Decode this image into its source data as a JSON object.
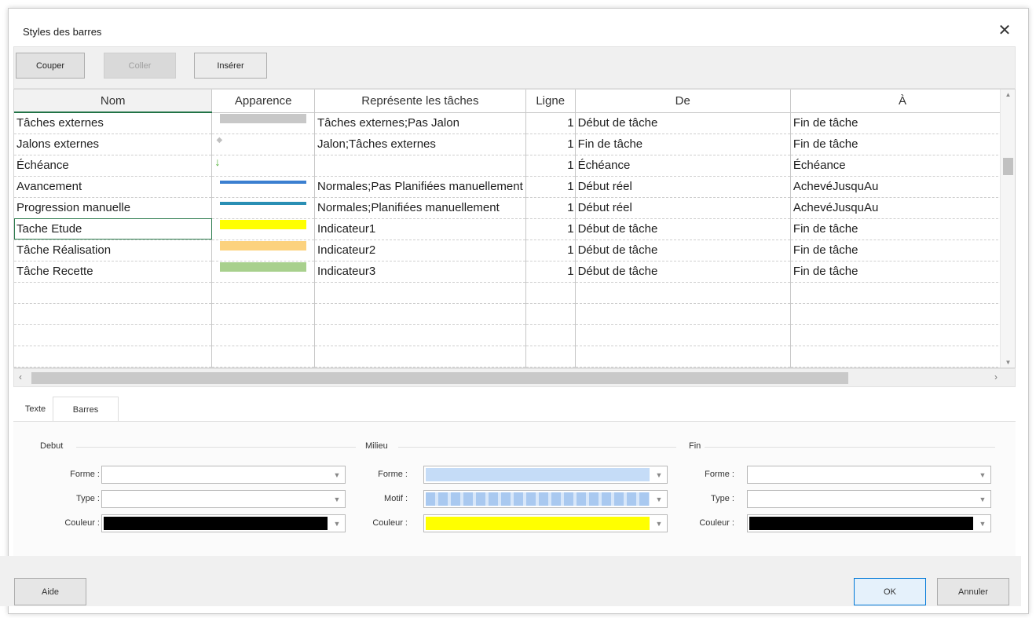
{
  "dialog": {
    "title": "Styles des barres",
    "close": "✕"
  },
  "toolbar": {
    "couper": "Couper",
    "coller": "Coller",
    "inserer": "Insérer"
  },
  "grid": {
    "headers": [
      "Nom",
      "Apparence",
      "Représente les tâches",
      "Ligne",
      "De",
      "À"
    ],
    "rows": [
      {
        "nom": "Tâches externes",
        "appearance": "gray-bar",
        "represente": "Tâches externes;Pas Jalon",
        "ligne": "1",
        "de": "Début de tâche",
        "a": "Fin de tâche"
      },
      {
        "nom": "Jalons externes",
        "appearance": "gray-diamond",
        "represente": "Jalon;Tâches externes",
        "ligne": "1",
        "de": "Fin de tâche",
        "a": "Fin de tâche"
      },
      {
        "nom": "Échéance",
        "appearance": "green-arrow",
        "represente": "",
        "ligne": "1",
        "de": "Échéance",
        "a": "Échéance"
      },
      {
        "nom": "Avancement",
        "appearance": "blue-line",
        "represente": "Normales;Pas Planifiées manuellement",
        "ligne": "1",
        "de": "Début réel",
        "a": "AchevéJusquAu"
      },
      {
        "nom": "Progression manuelle",
        "appearance": "teal-line",
        "represente": "Normales;Planifiées manuellement",
        "ligne": "1",
        "de": "Début réel",
        "a": "AchevéJusquAu"
      },
      {
        "nom": "Tache Etude",
        "appearance": "yellow-bar",
        "represente": "Indicateur1",
        "ligne": "1",
        "de": "Début de tâche",
        "a": "Fin de tâche"
      },
      {
        "nom": "Tâche Réalisation",
        "appearance": "orange-bar",
        "represente": "Indicateur2",
        "ligne": "1",
        "de": "Début de tâche",
        "a": "Fin de tâche"
      },
      {
        "nom": "Tâche Recette",
        "appearance": "green-bar",
        "represente": "Indicateur3",
        "ligne": "1",
        "de": "Début de tâche",
        "a": "Fin de tâche"
      }
    ],
    "appearance_colors": {
      "gray-bar": "#c8c8c8",
      "gray-diamond": "#c0c0c0",
      "green-arrow": "#4caf30",
      "blue-line": "#3b7fd0",
      "teal-line": "#2a8fb4",
      "yellow-bar": "#ffff00",
      "orange-bar": "#fcd27e",
      "green-bar": "#a8d08d"
    }
  },
  "tabs": {
    "texte": "Texte",
    "barres": "Barres"
  },
  "panel": {
    "debut": {
      "title": "Debut",
      "forme_label": "Forme :",
      "type_label": "Type :",
      "couleur_label": "Couleur :",
      "couleur": "#000000"
    },
    "milieu": {
      "title": "Milieu",
      "forme_label": "Forme :",
      "motif_label": "Motif :",
      "couleur_label": "Couleur :",
      "forme_color": "#c5dcf7",
      "motif_color": "#a9c9f0",
      "couleur": "#ffff00"
    },
    "fin": {
      "title": "Fin",
      "forme_label": "Forme :",
      "type_label": "Type :",
      "couleur_label": "Couleur :",
      "couleur": "#000000"
    }
  },
  "footer": {
    "aide": "Aide",
    "ok": "OK",
    "annuler": "Annuler"
  }
}
